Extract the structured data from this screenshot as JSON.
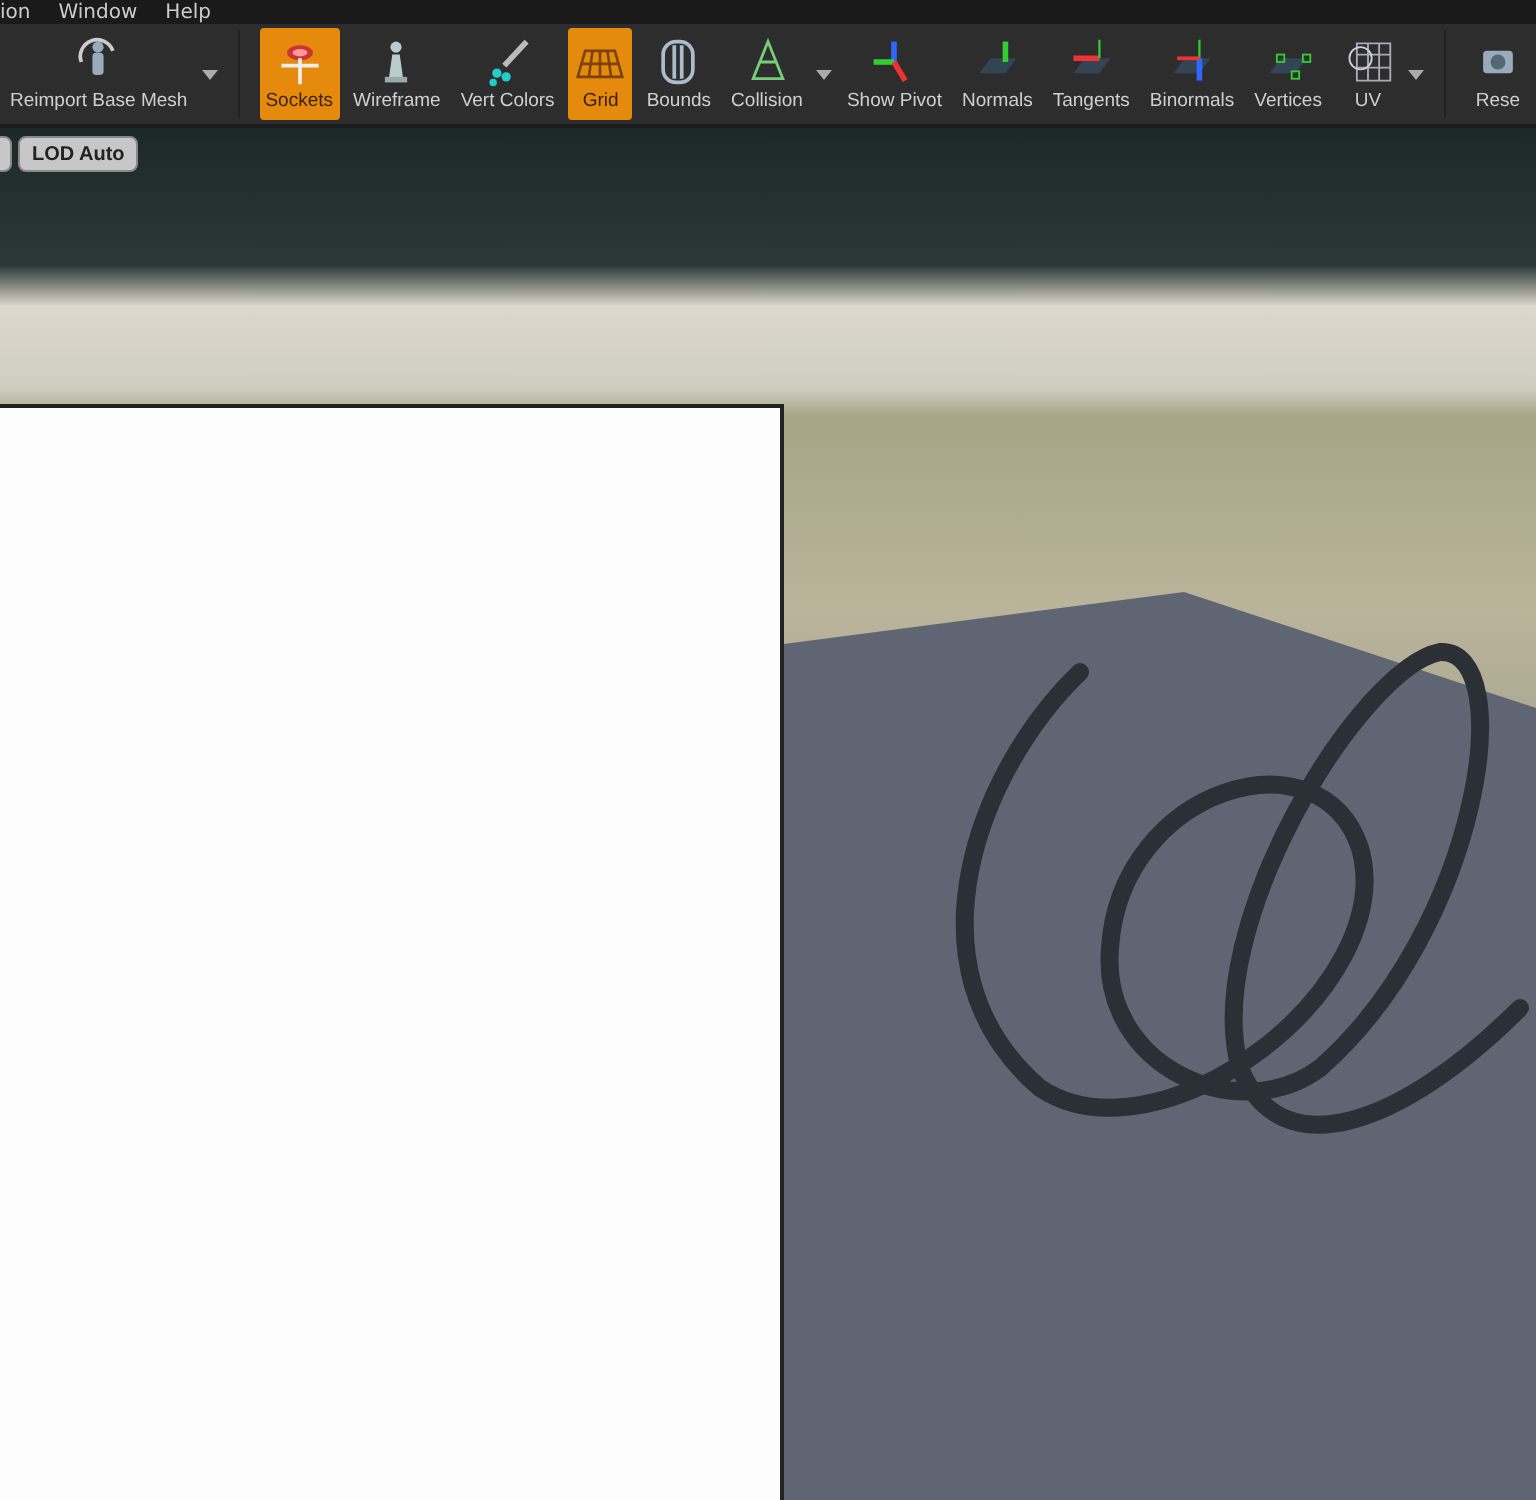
{
  "menu_bar": {
    "items": [
      {
        "label": "ion"
      },
      {
        "label": "Window"
      },
      {
        "label": "Help"
      }
    ]
  },
  "toolbar": {
    "groups": [
      {
        "buttons": [
          {
            "label": "Reimport Base Mesh",
            "selected": false,
            "dropdown": true
          }
        ]
      },
      {
        "buttons": [
          {
            "label": "Sockets",
            "selected": true,
            "dropdown": false
          },
          {
            "label": "Wireframe",
            "selected": false,
            "dropdown": false
          },
          {
            "label": "Vert Colors",
            "selected": false,
            "dropdown": false
          },
          {
            "label": "Grid",
            "selected": true,
            "dropdown": false
          },
          {
            "label": "Bounds",
            "selected": false,
            "dropdown": false
          },
          {
            "label": "Collision",
            "selected": false,
            "dropdown": true
          },
          {
            "label": "Show Pivot",
            "selected": false,
            "dropdown": false
          },
          {
            "label": "Normals",
            "selected": false,
            "dropdown": false
          },
          {
            "label": "Tangents",
            "selected": false,
            "dropdown": false
          },
          {
            "label": "Binormals",
            "selected": false,
            "dropdown": false
          },
          {
            "label": "Vertices",
            "selected": false,
            "dropdown": false
          },
          {
            "label": "UV",
            "selected": false,
            "dropdown": true
          }
        ]
      },
      {
        "buttons": [
          {
            "label": "Rese",
            "selected": false,
            "dropdown": false
          }
        ]
      }
    ]
  },
  "viewport": {
    "lod_button": {
      "label": "LOD Auto"
    }
  }
}
